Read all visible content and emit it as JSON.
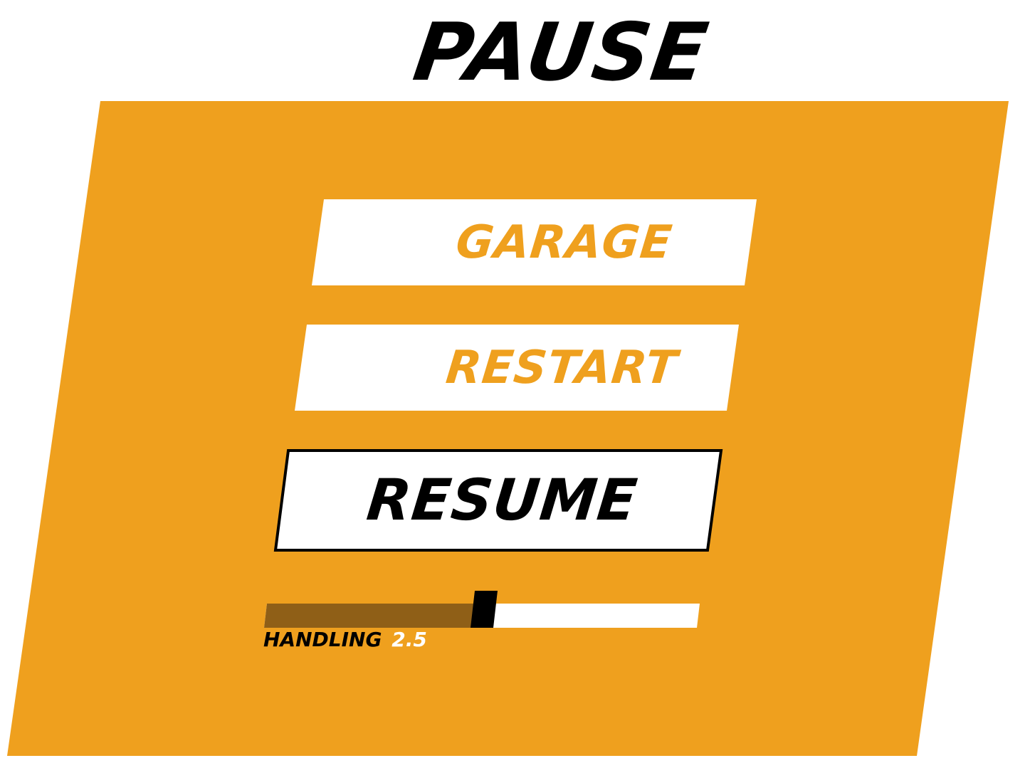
{
  "title": "PAUSE",
  "colors": {
    "panel": "#EFA01E",
    "button_bg": "#FFFFFF",
    "button_text": "#EFA01E",
    "selected_text": "#000000",
    "bar_fill": "#8F5F17",
    "bar_track": "#FFFFFF",
    "handle": "#000000"
  },
  "menu": {
    "garage_label": "GARAGE",
    "restart_label": "RESTART",
    "resume_label": "RESUME",
    "selected": "RESUME"
  },
  "stat": {
    "label": "HANDLING",
    "value": "2.5",
    "fill_fraction": 0.5
  }
}
